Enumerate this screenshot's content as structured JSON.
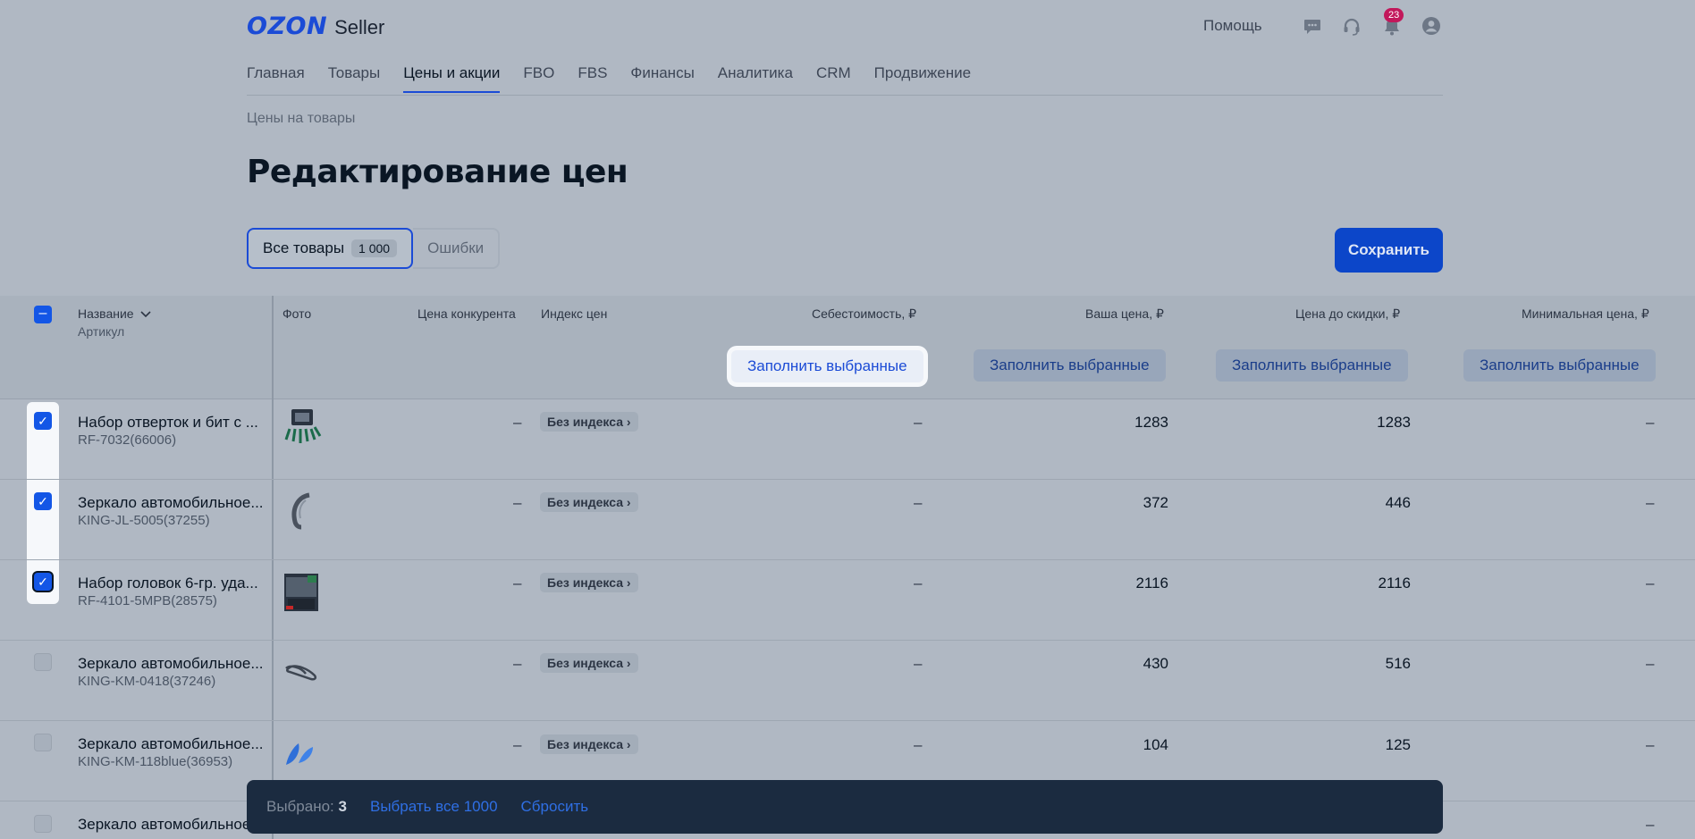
{
  "header": {
    "logo_brand": "OZON",
    "logo_sub": "Seller",
    "help": "Помощь",
    "notifications_count": "23"
  },
  "nav": [
    "Главная",
    "Товары",
    "Цены и акции",
    "FBO",
    "FBS",
    "Финансы",
    "Аналитика",
    "CRM",
    "Продвижение"
  ],
  "nav_active": "Цены и акции",
  "breadcrumb": "Цены на товары",
  "page_title": "Редактирование цен",
  "filters": {
    "all_label": "Все товары",
    "all_count": "1 000",
    "errors_label": "Ошибки"
  },
  "save_label": "Сохранить",
  "table": {
    "columns": {
      "name": "Название",
      "sku": "Артикул",
      "photo": "Фото",
      "competitor": "Цена конкурента",
      "index": "Индекс цен",
      "cost": "Себестоимость, ₽",
      "your_price": "Ваша цена, ₽",
      "old_price": "Цена до скидки, ₽",
      "min_price": "Минимальная цена, ₽"
    },
    "fill_label": "Заполнить выбранные",
    "rows": [
      {
        "name": "Набор отверток и бит с ...",
        "sku": "RF-7032(66006)",
        "competitor": "–",
        "index": "Без индекса",
        "cost": "–",
        "your_price": "1283",
        "old_price": "1283",
        "min_price": "–",
        "checked": true
      },
      {
        "name": "Зеркало автомобильное...",
        "sku": "KING-JL-5005(37255)",
        "competitor": "–",
        "index": "Без индекса",
        "cost": "–",
        "your_price": "372",
        "old_price": "446",
        "min_price": "–",
        "checked": true
      },
      {
        "name": "Набор головок 6-гр. уда...",
        "sku": "RF-4101-5MPB(28575)",
        "competitor": "–",
        "index": "Без индекса",
        "cost": "–",
        "your_price": "2116",
        "old_price": "2116",
        "min_price": "–",
        "checked": true
      },
      {
        "name": "Зеркало автомобильное...",
        "sku": "KING-KM-0418(37246)",
        "competitor": "–",
        "index": "Без индекса",
        "cost": "–",
        "your_price": "430",
        "old_price": "516",
        "min_price": "–",
        "checked": false
      },
      {
        "name": "Зеркало автомобильное...",
        "sku": "KING-KM-118blue(36953)",
        "competitor": "–",
        "index": "Без индекса",
        "cost": "–",
        "your_price": "104",
        "old_price": "125",
        "min_price": "–",
        "checked": false
      },
      {
        "name": "Зеркало автомобильное...",
        "sku": "",
        "competitor": "",
        "index": "",
        "cost": "",
        "your_price": "",
        "old_price": "",
        "min_price": "–",
        "checked": false
      }
    ]
  },
  "bottom_bar": {
    "selected_label": "Выбрано:",
    "selected_count": "3",
    "select_all": "Выбрать все 1000",
    "reset": "Сбросить"
  },
  "colors": {
    "accent": "#1b4bd6",
    "save_bg": "#0c46c9",
    "bar_bg": "#1b2b40",
    "badge": "#c2185b"
  },
  "icons": [
    "chat-icon",
    "headset-icon",
    "bell-icon",
    "profile-icon",
    "chevron-down-icon",
    "chevron-right-icon",
    "check-icon"
  ]
}
